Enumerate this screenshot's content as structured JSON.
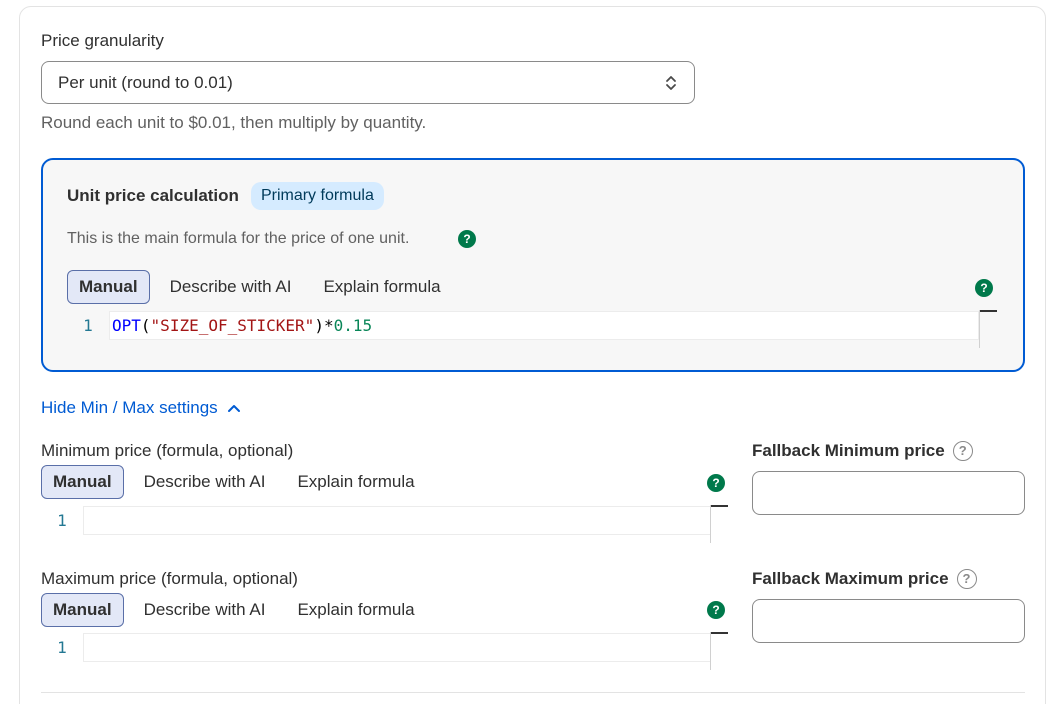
{
  "granularity": {
    "label": "Price granularity",
    "selected": "Per unit (round to 0.01)",
    "help": "Round each unit to $0.01, then multiply by quantity."
  },
  "unit_calc": {
    "title": "Unit price calculation",
    "badge": "Primary formula",
    "description": "This is the main formula for the price of one unit.",
    "tabs": [
      "Manual",
      "Describe with AI",
      "Explain formula"
    ],
    "line_number": "1",
    "code": {
      "fn": "OPT",
      "open": "(",
      "str": "\"SIZE_OF_STICKER\"",
      "close": ")*",
      "num": "0.15"
    }
  },
  "toggle": {
    "label": "Hide Min / Max settings"
  },
  "min_price": {
    "label": "Minimum price (formula, optional)",
    "tabs": [
      "Manual",
      "Describe with AI",
      "Explain formula"
    ],
    "line_number": "1",
    "fallback_label": "Fallback Minimum price"
  },
  "max_price": {
    "label": "Maximum price (formula, optional)",
    "tabs": [
      "Manual",
      "Describe with AI",
      "Explain formula"
    ],
    "line_number": "1",
    "fallback_label": "Fallback Maximum price"
  },
  "icons": {
    "help_dot": "?",
    "question": "?"
  },
  "colors": {
    "accent": "#005bd3",
    "help_green": "#00794b",
    "badge_bg": "#d5ebff"
  }
}
